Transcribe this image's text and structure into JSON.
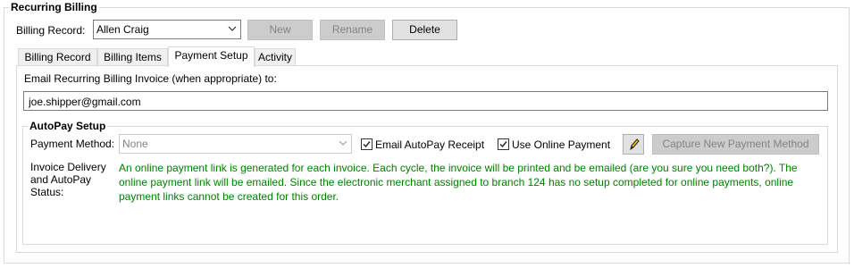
{
  "group": {
    "title": "Recurring Billing"
  },
  "billing_record": {
    "label": "Billing Record:",
    "value": "Allen Craig"
  },
  "buttons": {
    "new": "New",
    "rename": "Rename",
    "delete": "Delete",
    "capture": "Capture New Payment Method"
  },
  "tabs": [
    {
      "label": "Billing Record",
      "active": false
    },
    {
      "label": "Billing Items",
      "active": false
    },
    {
      "label": "Payment Setup",
      "active": true
    },
    {
      "label": "Activity",
      "active": false
    }
  ],
  "email": {
    "label": "Email Recurring Billing Invoice (when appropriate) to:",
    "value": "joe.shipper@gmail.com"
  },
  "autopay": {
    "title": "AutoPay Setup",
    "payment_method_label": "Payment Method:",
    "payment_method_value": "None",
    "email_receipt_label": "Email AutoPay Receipt",
    "email_receipt_checked": true,
    "use_online_label": "Use Online Payment",
    "use_online_checked": true,
    "status_label": "Invoice Delivery and AutoPay Status:",
    "status_text": "An online payment link is generated for each invoice.  Each cycle, the invoice will be printed and be emailed (are you sure you need both?).  The online payment link will be emailed.  Since the electronic merchant assigned to branch 124 has no setup completed for online payments, online payment links cannot be created for this order."
  },
  "colors": {
    "status_text": "#008000"
  },
  "icons": {
    "edit": "pencil-icon",
    "dropdown": "chevron-down-icon",
    "check": "check-icon"
  }
}
